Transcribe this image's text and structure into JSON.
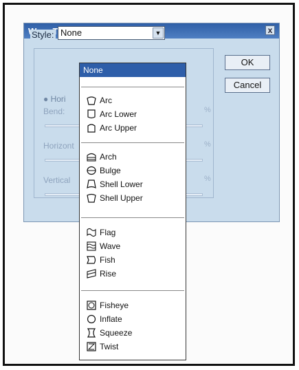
{
  "dialog": {
    "title": "Warp Text",
    "close_label": "x"
  },
  "style": {
    "label": "Style:",
    "selected": "None"
  },
  "buttons": {
    "ok": "OK",
    "cancel": "Cancel"
  },
  "bg_labels": {
    "horizontal_radio": "Hori",
    "bend": "Bend:",
    "horizontal_distortion": "Horizont",
    "vertical_distortion": "Vertical",
    "percent": "%"
  },
  "menu": {
    "highlighted": "None",
    "group1": [
      {
        "label": "Arc",
        "icon": "arc-icon"
      },
      {
        "label": "Arc Lower",
        "icon": "arc-lower-icon"
      },
      {
        "label": "Arc Upper",
        "icon": "arc-upper-icon"
      }
    ],
    "group2": [
      {
        "label": "Arch",
        "icon": "arch-icon"
      },
      {
        "label": "Bulge",
        "icon": "bulge-icon"
      },
      {
        "label": "Shell Lower",
        "icon": "shell-lower-icon"
      },
      {
        "label": "Shell Upper",
        "icon": "shell-upper-icon"
      }
    ],
    "group3": [
      {
        "label": "Flag",
        "icon": "flag-icon"
      },
      {
        "label": "Wave",
        "icon": "wave-icon"
      },
      {
        "label": "Fish",
        "icon": "fish-icon"
      },
      {
        "label": "Rise",
        "icon": "rise-icon"
      }
    ],
    "group4": [
      {
        "label": "Fisheye",
        "icon": "fisheye-icon"
      },
      {
        "label": "Inflate",
        "icon": "inflate-icon"
      },
      {
        "label": "Squeeze",
        "icon": "squeeze-icon"
      },
      {
        "label": "Twist",
        "icon": "twist-icon"
      }
    ]
  },
  "colors": {
    "dialog_bg": "#c9dcec",
    "titlebar": "#2f5fa7",
    "highlight": "#2e5ea9"
  }
}
